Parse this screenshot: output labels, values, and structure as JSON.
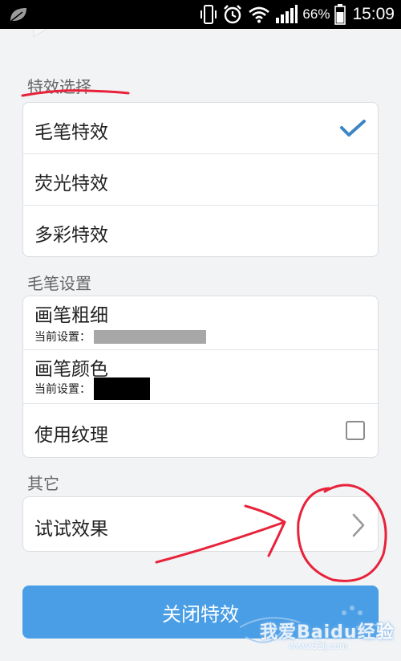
{
  "status_bar": {
    "battery_percent": "66%",
    "time": "15:09",
    "icons": [
      "leaf-icon",
      "vibrate-icon",
      "alarm-icon",
      "wifi-icon",
      "signal-icon",
      "battery-icon"
    ]
  },
  "sections": {
    "effect_select": {
      "title": "特效选择",
      "items": [
        {
          "label": "毛笔特效",
          "selected": true
        },
        {
          "label": "荧光特效",
          "selected": false
        },
        {
          "label": "多彩特效",
          "selected": false
        }
      ]
    },
    "brush_settings": {
      "title": "毛笔设置",
      "thickness": {
        "label": "画笔粗细",
        "current_label": "当前设置："
      },
      "color": {
        "label": "画笔颜色",
        "current_label": "当前设置："
      },
      "texture": {
        "label": "使用纹理",
        "checked": false
      }
    },
    "other": {
      "title": "其它",
      "try_effect": {
        "label": "试试效果"
      }
    }
  },
  "close_button": {
    "label": "关闭特效"
  },
  "watermark": {
    "main": "我爱Baidu经验",
    "sub": "www.52ij.com"
  },
  "colors": {
    "accent": "#4a9ee6",
    "check": "#3d85c6",
    "annotation": "#e8223a"
  }
}
